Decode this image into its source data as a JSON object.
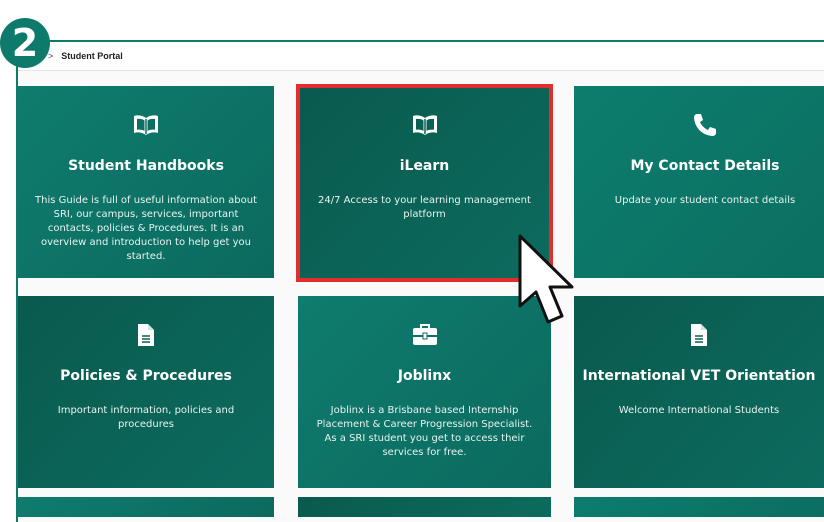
{
  "step": {
    "number": "2"
  },
  "breadcrumb": {
    "separator": ">",
    "current": "Student Portal"
  },
  "tiles": [
    {
      "icon": "book-icon",
      "title": "Student Handbooks",
      "description": "This Guide is full of useful information about SRI, our campus, services, important contacts, policies & Procedures. It is an overview and introduction to help get you started."
    },
    {
      "icon": "book-icon",
      "title": "iLearn",
      "description": "24/7 Access to your learning management platform"
    },
    {
      "icon": "phone-icon",
      "title": "My Contact Details",
      "description": "Update your student contact details"
    },
    {
      "icon": "document-icon",
      "title": "Policies & Procedures",
      "description": "Important information, policies and procedures"
    },
    {
      "icon": "briefcase-icon",
      "title": "Joblinx",
      "description": "Joblinx is a Brisbane based Internship Placement & Career Progression Specialist. As a SRI student you get to access their services for free."
    },
    {
      "icon": "document-icon",
      "title": "International VET Orientation",
      "description": "Welcome International Students"
    }
  ],
  "colors": {
    "accent": "#0e7a6c",
    "highlight": "#e02d2d"
  }
}
